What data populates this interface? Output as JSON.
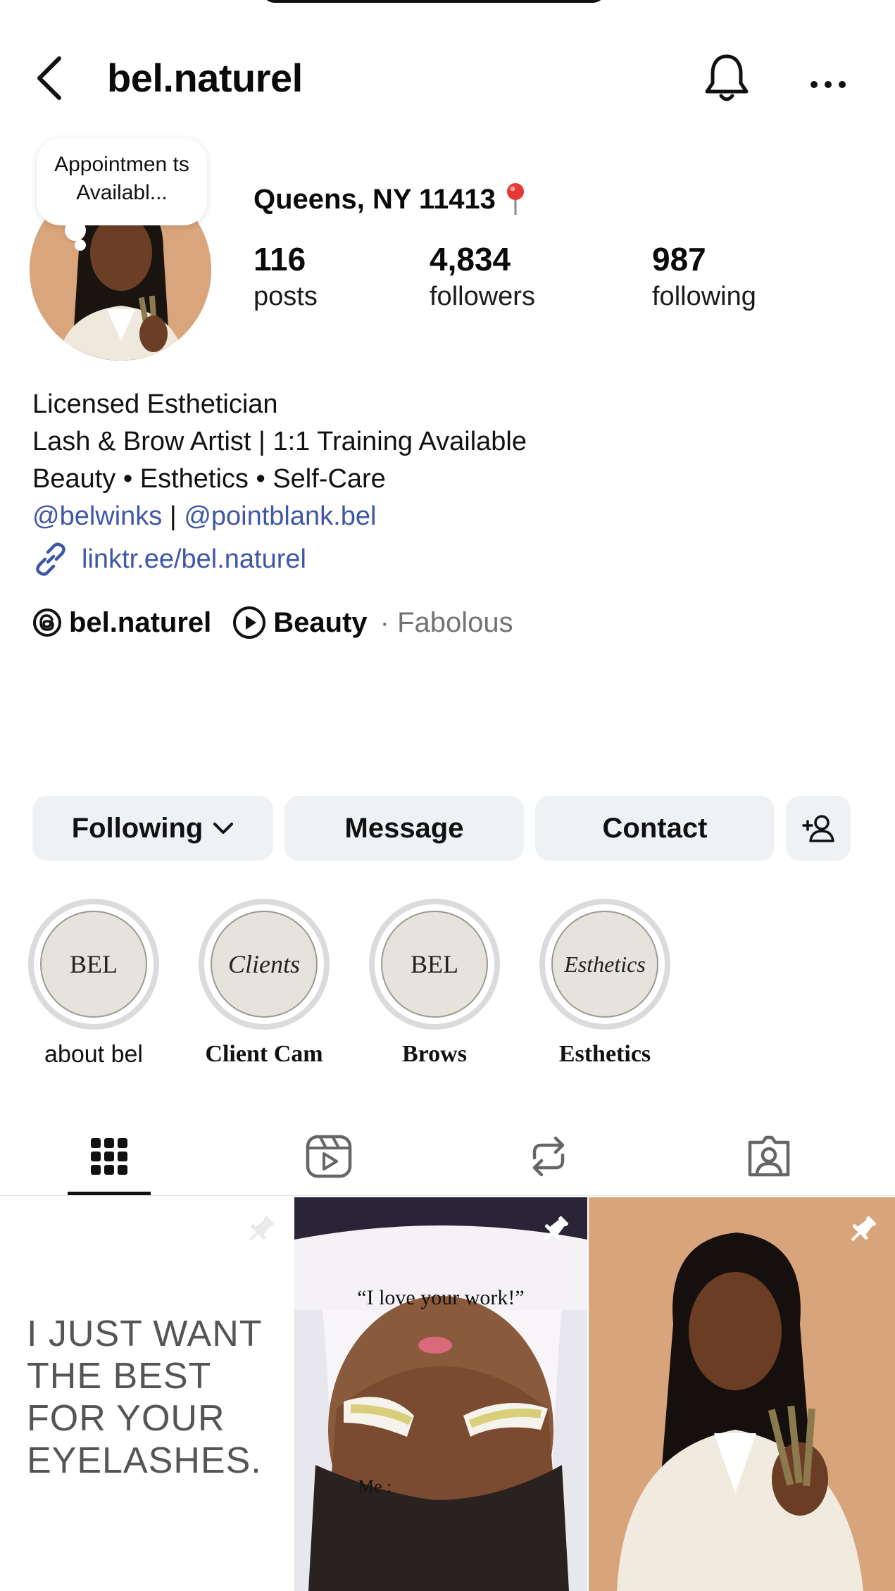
{
  "header": {
    "username": "bel.naturel",
    "icons": {
      "back": "back-chevron-icon",
      "bell": "bell-icon",
      "more": "more-options-icon"
    }
  },
  "profile": {
    "note": "Appointmen ts Availabl...",
    "location": "Queens, NY 11413",
    "location_icon": "map-pin-icon",
    "stats": [
      {
        "value": "116",
        "label": "posts"
      },
      {
        "value": "4,834",
        "label": "followers"
      },
      {
        "value": "987",
        "label": "following"
      }
    ]
  },
  "bio": {
    "line1": "Licensed Esthetician",
    "line2": "Lash & Brow Artist | 1:1 Training Available",
    "line3": "Beauty • Esthetics • Self-Care",
    "mention1": "@belwinks",
    "separator": " | ",
    "mention2": "@pointblank.bel",
    "link": "linktr.ee/bel.naturel",
    "threads_handle": "bel.naturel",
    "category": "Beauty",
    "category_sub": "· Fabolous"
  },
  "actions": {
    "following": "Following",
    "message": "Message",
    "contact": "Contact"
  },
  "highlights": [
    {
      "cover": "BEL",
      "label": "about bel"
    },
    {
      "cover": "Clients",
      "label": "Client Cam"
    },
    {
      "cover": "BEL",
      "label": "Brows"
    },
    {
      "cover": "Esthetics",
      "label": "Esthetics"
    }
  ],
  "tabs": [
    "grid-icon",
    "reels-icon",
    "reposts-icon",
    "tagged-icon"
  ],
  "posts": [
    {
      "text": "I JUST WANT THE BEST FOR YOUR EYELASHES.",
      "pinned": true
    },
    {
      "caption_top": "“I love your work!”",
      "caption_bottom": "Me :",
      "pinned": true
    },
    {
      "pinned": true
    }
  ],
  "colors": {
    "link": "#3f57a6",
    "button_bg": "#eff2f5",
    "muted": "#737373"
  }
}
